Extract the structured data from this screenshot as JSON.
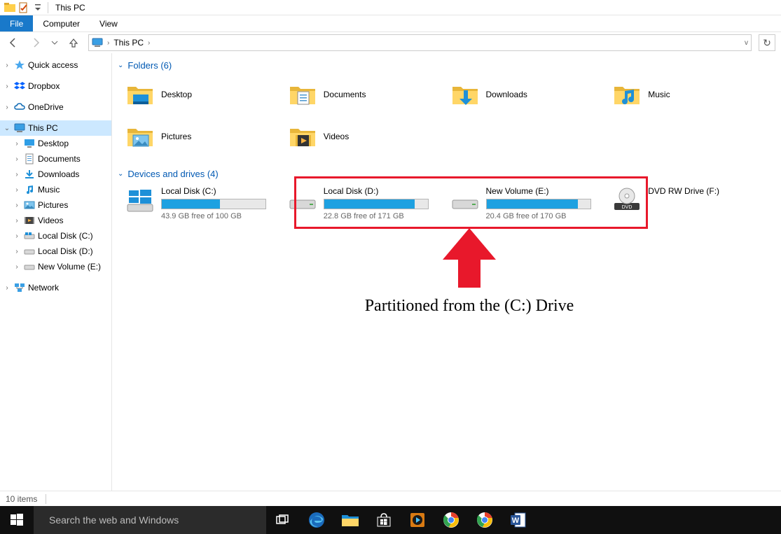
{
  "window": {
    "title": "This PC"
  },
  "ribbon": {
    "file": "File",
    "tabs": [
      "Computer",
      "View"
    ]
  },
  "address": {
    "crumb0": "This PC"
  },
  "tree": {
    "quick_access": "Quick access",
    "dropbox": "Dropbox",
    "onedrive": "OneDrive",
    "this_pc": "This PC",
    "desktop": "Desktop",
    "documents": "Documents",
    "downloads": "Downloads",
    "music": "Music",
    "pictures": "Pictures",
    "videos": "Videos",
    "local_c": "Local Disk (C:)",
    "local_d": "Local Disk (D:)",
    "new_vol_e": "New Volume (E:)",
    "network": "Network"
  },
  "groups": {
    "folders_label": "Folders (6)",
    "drives_label": "Devices and drives (4)"
  },
  "folders": {
    "desktop": "Desktop",
    "documents": "Documents",
    "downloads": "Downloads",
    "music": "Music",
    "pictures": "Pictures",
    "videos": "Videos"
  },
  "drives": {
    "c": {
      "name": "Local Disk (C:)",
      "sub": "43.9 GB free of 100 GB",
      "used_pct": 56
    },
    "d": {
      "name": "Local Disk (D:)",
      "sub": "22.8 GB free of 171 GB",
      "used_pct": 87
    },
    "e": {
      "name": "New Volume (E:)",
      "sub": "20.4 GB free of 170 GB",
      "used_pct": 88
    },
    "f": {
      "name": "DVD RW Drive (F:)"
    }
  },
  "annotation": "Partitioned from the (C:) Drive",
  "status": {
    "items": "10 items"
  },
  "taskbar": {
    "search_placeholder": "Search the web and Windows"
  }
}
